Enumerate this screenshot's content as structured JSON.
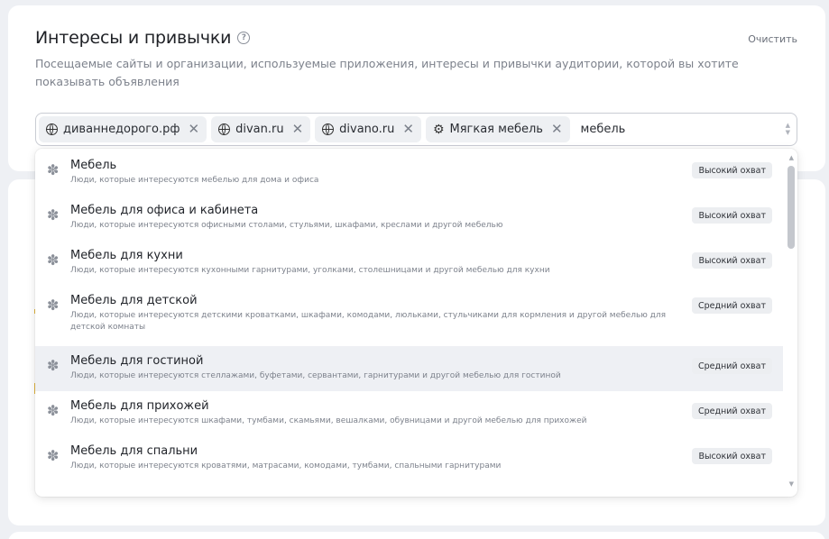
{
  "section": {
    "title": "Интересы и привычки",
    "help_icon": "question-circle-icon",
    "clear_label": "Очистить",
    "subtitle": "Посещаемые сайты и организации, используемые приложения, интересы и привычки аудитории, которой вы хотите показывать объявления"
  },
  "tags": [
    {
      "label": "диваннедорого.рф",
      "icon": "globe-icon"
    },
    {
      "label": "divan.ru",
      "icon": "globe-icon"
    },
    {
      "label": "divano.ru",
      "icon": "globe-icon"
    },
    {
      "label": "Мягкая мебель",
      "icon": "puzzle-icon"
    }
  ],
  "search": {
    "value": "мебель"
  },
  "options": [
    {
      "title": "Мебель",
      "desc": "Люди, которые интересуются мебелью для дома и офиса",
      "badge": "Высокий охват"
    },
    {
      "title": "Мебель для офиса и кабинета",
      "desc": "Люди, которые интересуются офисными столами, стульями, шкафами, креслами и другой мебелью",
      "badge": "Высокий охват"
    },
    {
      "title": "Мебель для кухни",
      "desc": "Люди, которые интересуются кухонными гарнитурами, уголками, столешницами и другой мебелью для кухни",
      "badge": "Высокий охват"
    },
    {
      "title": "Мебель для детской",
      "desc": "Люди, которые интересуются детскими кроватками, шкафами, комодами, люльками, стульчиками для кормления и другой мебелью для детской комнаты",
      "badge": "Средний охват"
    },
    {
      "title": "Мебель для гостиной",
      "desc": "Люди, которые интересуются стеллажами, буфетами, сервантами, гарнитурами и другой мебелью для гостиной",
      "badge": "Средний охват"
    },
    {
      "title": "Мебель для прихожей",
      "desc": "Люди, которые интересуются шкафами, тумбами, скамьями, вешалками, обувницами и другой мебелью для прихожей",
      "badge": "Средний охват"
    },
    {
      "title": "Мебель для спальни",
      "desc": "Люди, которые интересуются кроватями, матрасами, комодами, тумбами, спальными гарнитурами",
      "badge": "Высокий охват"
    }
  ],
  "colors": {
    "accent_edge": "#e4b740",
    "active_row": "#eef0f4"
  }
}
